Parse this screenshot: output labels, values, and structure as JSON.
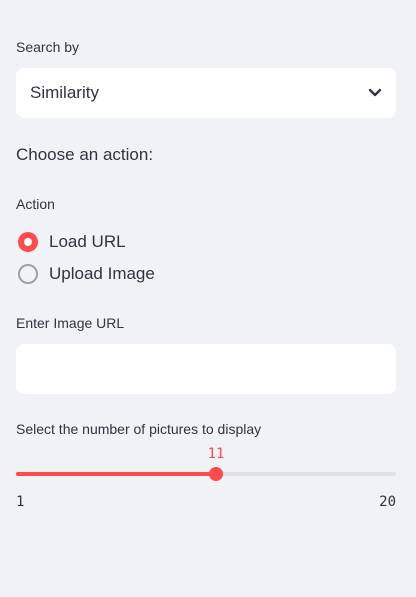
{
  "search": {
    "label": "Search by",
    "selected": "Similarity"
  },
  "action_heading": "Choose an action:",
  "action": {
    "label": "Action",
    "options": [
      {
        "label": "Load URL",
        "selected": true
      },
      {
        "label": "Upload Image",
        "selected": false
      }
    ]
  },
  "url": {
    "label": "Enter Image URL",
    "value": "",
    "placeholder": ""
  },
  "slider": {
    "label": "Select the number of pictures to display",
    "value": "11",
    "min": "1",
    "max": "20"
  },
  "colors": {
    "accent": "#ff4b4b",
    "background": "#f0f2f6",
    "text": "#31333f"
  }
}
